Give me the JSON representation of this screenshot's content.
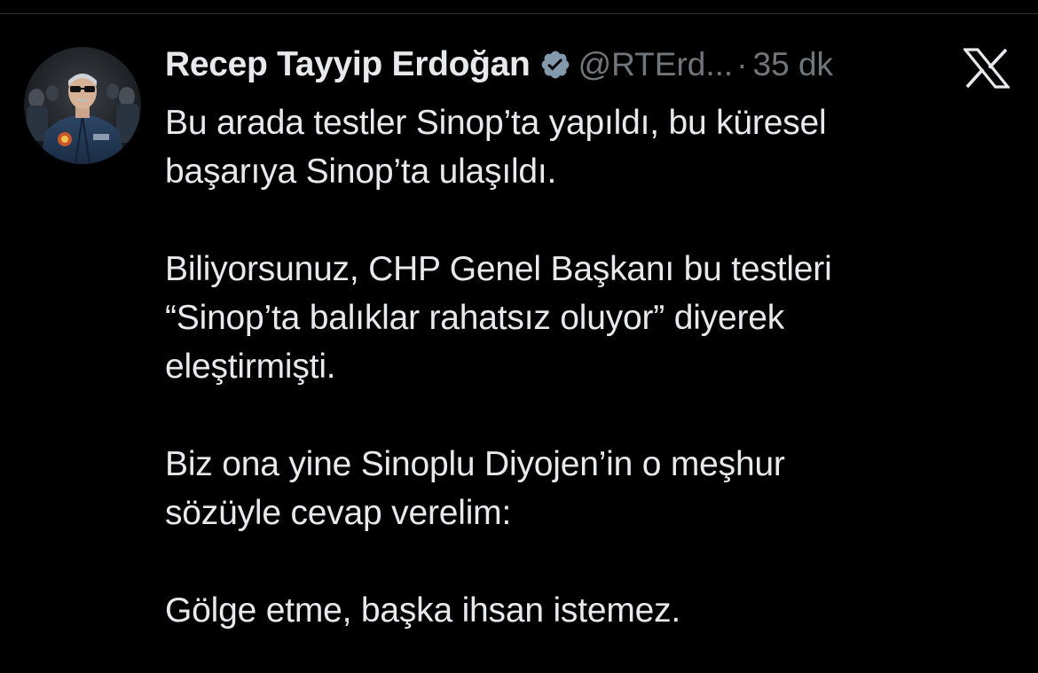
{
  "tweet": {
    "author": {
      "name": "Recep Tayyip Erdoğan",
      "handle": "@RTErd...",
      "verified_icon": "verified-badge-icon",
      "avatar": "avatar-photo"
    },
    "separator": "·",
    "time": "35 dk",
    "platform_icon": "x-logo-icon",
    "paragraphs": [
      {
        "lines": [
          "Bu arada testler Sinop’ta yapıldı, bu küresel",
          "başarıya Sinop’ta ulaşıldı."
        ]
      },
      {
        "lines": [
          "Biliyorsunuz, CHP Genel Başkanı bu testleri",
          "“Sinop’ta balıklar rahatsız oluyor” diyerek",
          "eleştirmişti."
        ]
      },
      {
        "lines": [
          "Biz ona yine Sinoplu Diyojen’in o meşhur",
          "sözüyle cevap verelim:"
        ]
      },
      {
        "lines": [
          "Gölge etme, başka ihsan istemez."
        ]
      }
    ]
  },
  "colors": {
    "background": "#000000",
    "text_primary": "#e7e9ea",
    "text_secondary": "#71767b",
    "verified_badge": "#829aab"
  }
}
